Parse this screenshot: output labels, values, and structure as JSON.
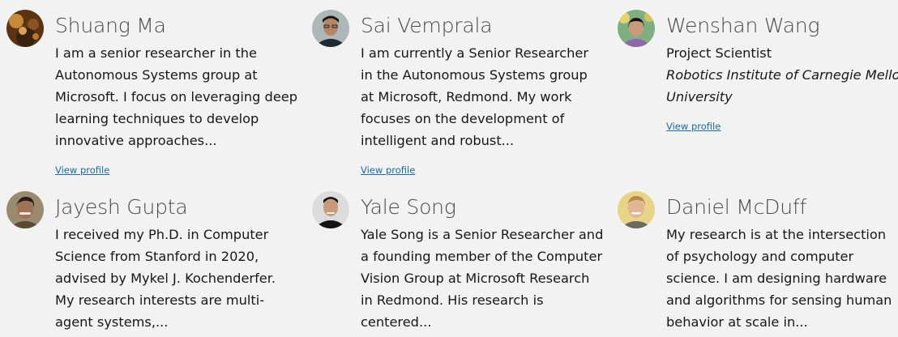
{
  "people": [
    {
      "name": "Shuang Ma",
      "bio": "I am a senior researcher in the Autonomous Systems group at Microsoft. I focus on leveraging deep learning techniques to develop innovative approaches...",
      "link": "View profile"
    },
    {
      "name": "Sai Vemprala",
      "bio": "I am currently a Senior Researcher in the Autonomous Systems group at Microsoft, Redmond. My work focuses on the development of intelligent and robust...",
      "link": "View profile"
    },
    {
      "name": "Wenshan Wang",
      "title": "Project Scientist",
      "affiliation": "Robotics Institute of Carnegie Mellon University",
      "link": "View profile"
    },
    {
      "name": "Jayesh Gupta",
      "bio": "I received my Ph.D. in Computer Science from Stanford in 2020, advised by Mykel J. Kochenderfer. My research interests are multi-agent systems,..."
    },
    {
      "name": "Yale Song",
      "bio": "Yale Song is a Senior Researcher and a founding member of the Computer Vision Group at Microsoft Research in Redmond. His research is centered..."
    },
    {
      "name": "Daniel McDuff",
      "bio": "My research is at the intersection of psychology and computer science. I am designing hardware and algorithms for sensing human behavior at scale in..."
    }
  ]
}
